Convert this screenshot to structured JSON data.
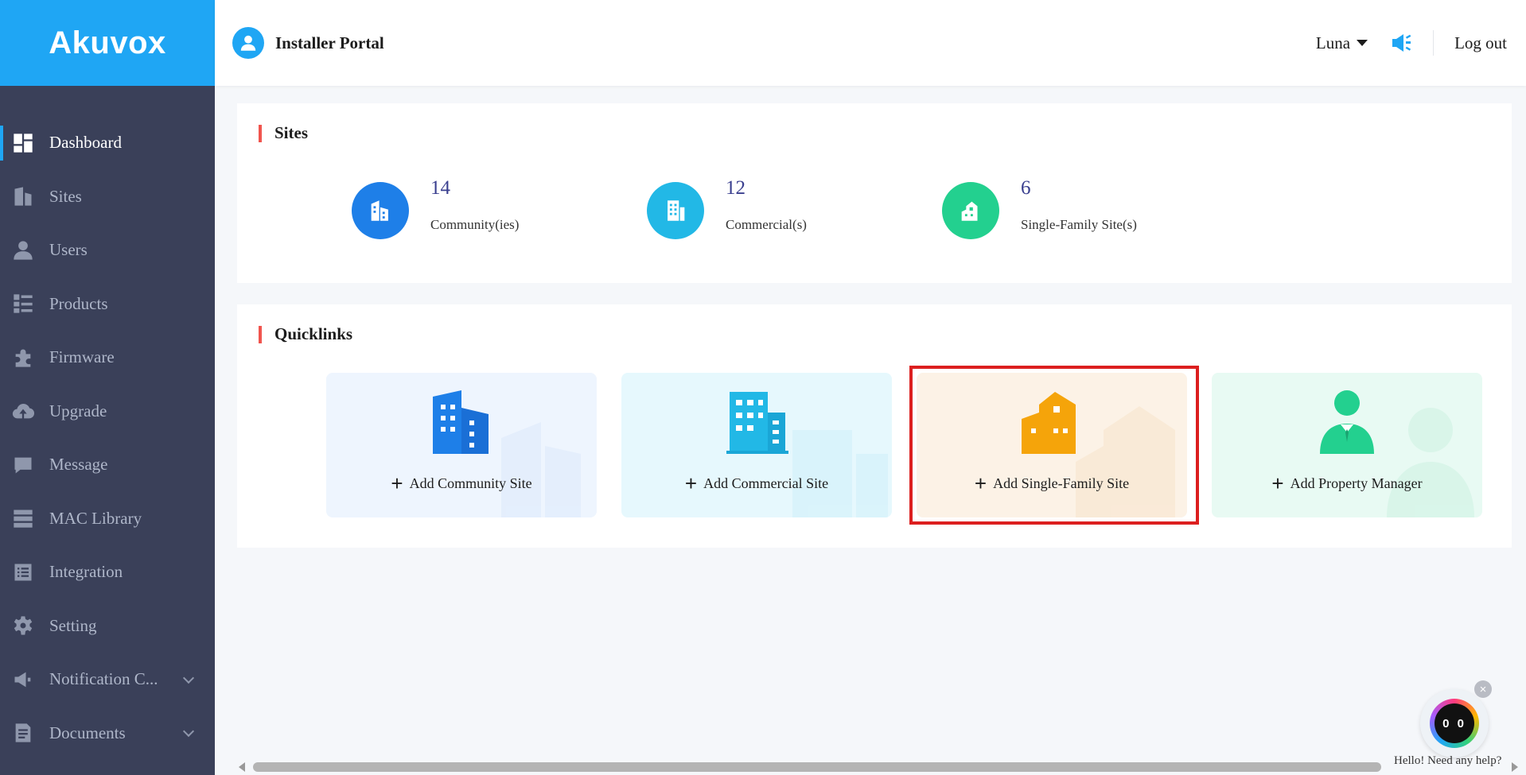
{
  "brand": {
    "logo_text": "Akuvox",
    "accent": "#1fa6f4",
    "sidebar_bg": "#3a4059"
  },
  "header": {
    "portal_title": "Installer Portal",
    "username": "Luna",
    "logout_label": "Log out"
  },
  "sidebar": {
    "items": [
      {
        "label": "Dashboard",
        "icon": "dashboard-icon",
        "active": true
      },
      {
        "label": "Sites",
        "icon": "building-icon"
      },
      {
        "label": "Users",
        "icon": "user-icon"
      },
      {
        "label": "Products",
        "icon": "list-icon"
      },
      {
        "label": "Firmware",
        "icon": "puzzle-icon"
      },
      {
        "label": "Upgrade",
        "icon": "cloud-upload-icon"
      },
      {
        "label": "Message",
        "icon": "message-icon"
      },
      {
        "label": "MAC Library",
        "icon": "server-icon"
      },
      {
        "label": "Integration",
        "icon": "integration-icon"
      },
      {
        "label": "Setting",
        "icon": "gear-icon"
      },
      {
        "label": "Notification C...",
        "icon": "megaphone-icon",
        "expandable": true
      },
      {
        "label": "Documents",
        "icon": "document-icon",
        "expandable": true
      }
    ]
  },
  "sites": {
    "title": "Sites",
    "stats": [
      {
        "count": "14",
        "label": "Community(ies)",
        "color": "#1e7fe8"
      },
      {
        "count": "12",
        "label": "Commercial(s)",
        "color": "#22b8e6"
      },
      {
        "count": "6",
        "label": "Single-Family Site(s)",
        "color": "#23d08f"
      }
    ]
  },
  "quicklinks": {
    "title": "Quicklinks",
    "items": [
      {
        "label": "Add Community Site",
        "bg": "#eef5fe",
        "color": "#1e7fe8"
      },
      {
        "label": "Add Commercial Site",
        "bg": "#e6f8fd",
        "color": "#22b8e6"
      },
      {
        "label": "Add Single-Family Site",
        "bg": "#fcf2e6",
        "color": "#f5a40a",
        "highlighted": true
      },
      {
        "label": "Add Property Manager",
        "bg": "#e8faf3",
        "color": "#23d08f"
      }
    ]
  },
  "help_bot": {
    "face": "0 0",
    "text": "Hello! Need any help?",
    "close": "×"
  }
}
